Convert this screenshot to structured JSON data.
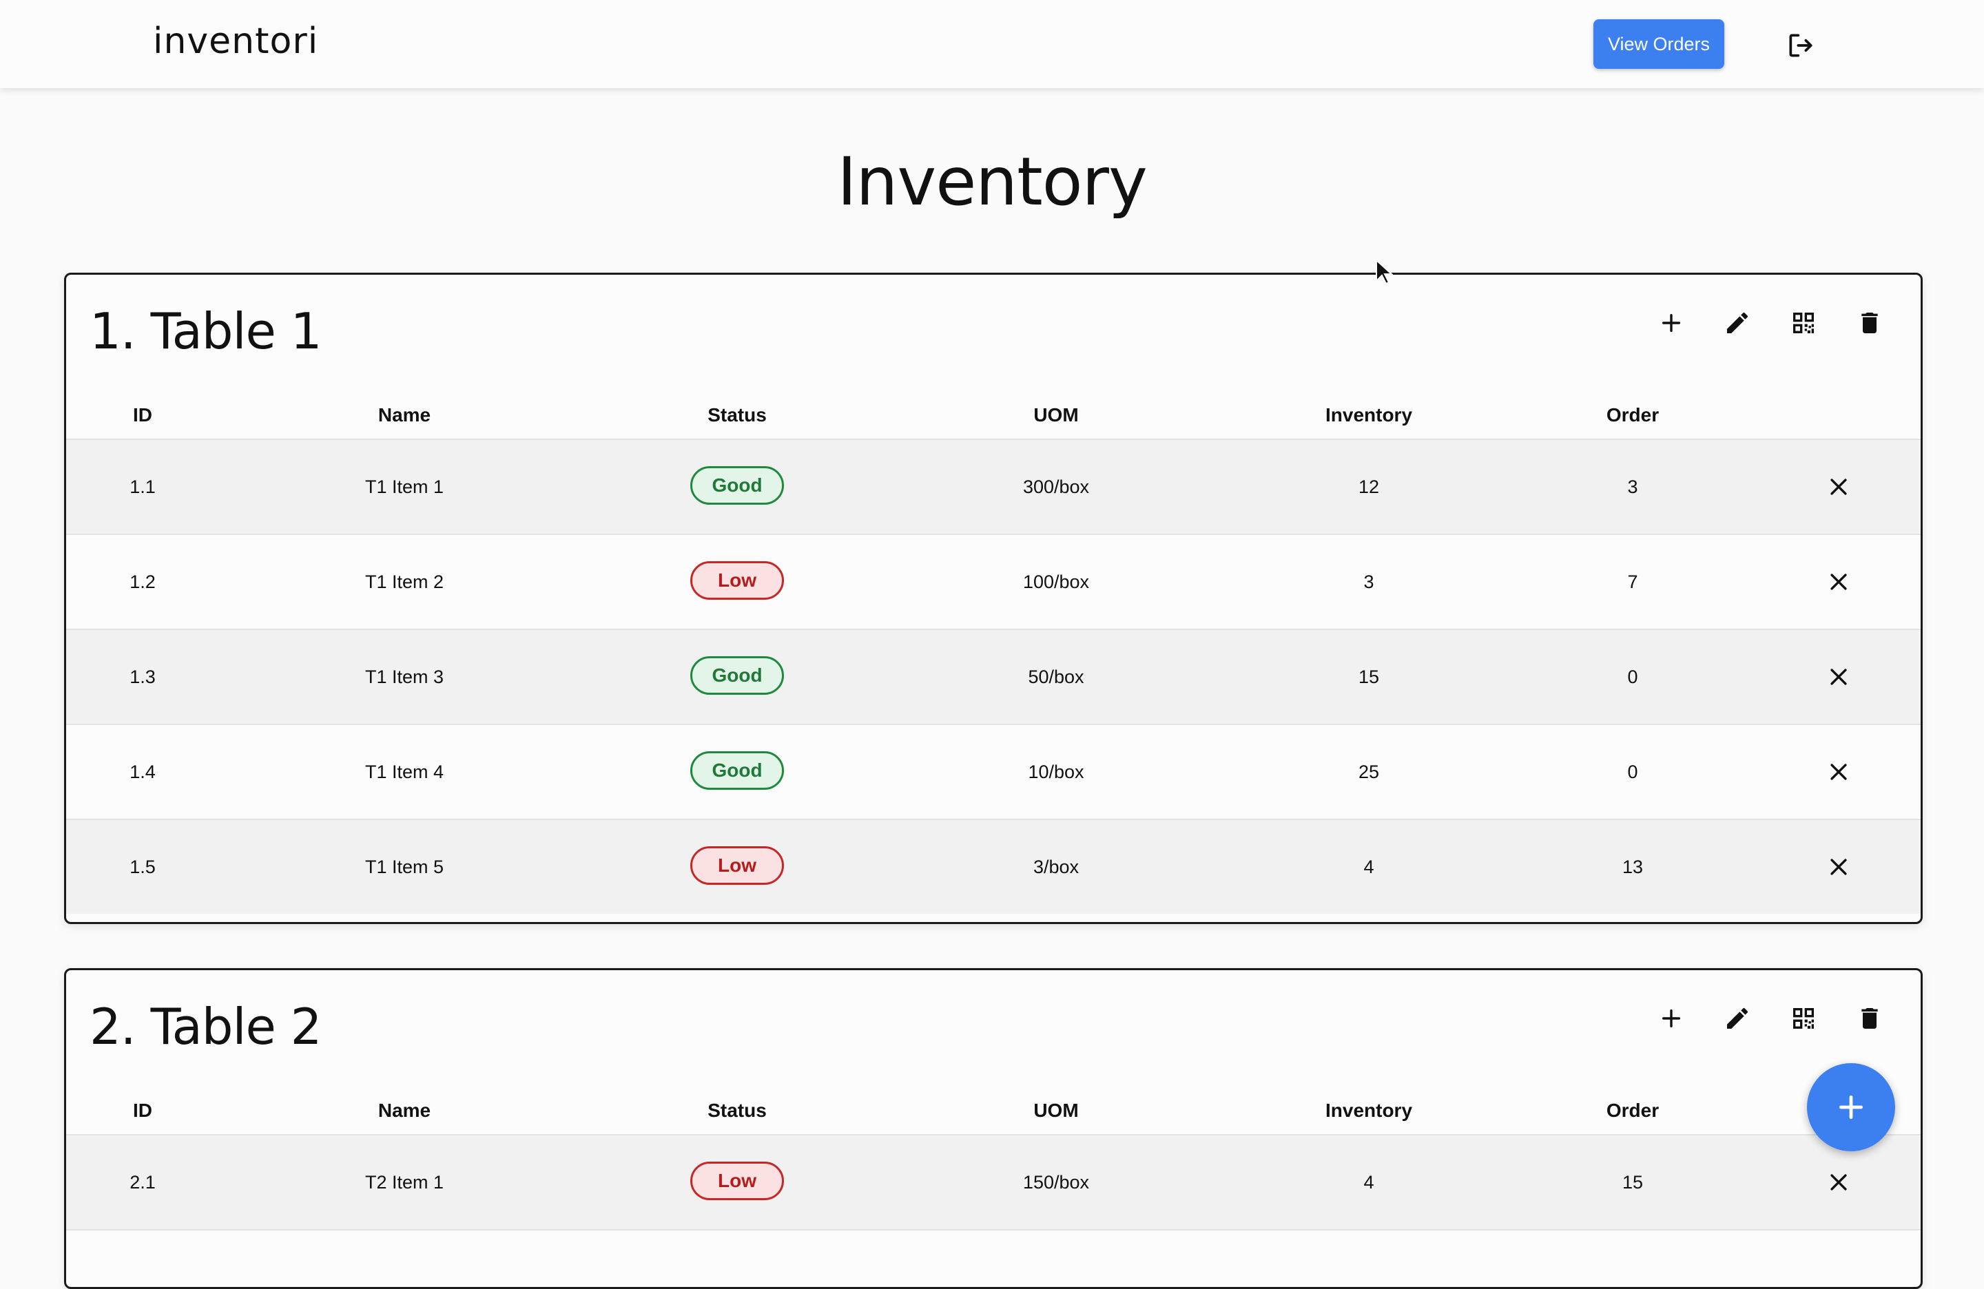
{
  "app": {
    "brand": "inventori",
    "view_orders_label": "View Orders",
    "page_title": "Inventory"
  },
  "icons": {
    "logout": "logout-icon",
    "add": "plus-icon",
    "edit": "pencil-icon",
    "qr": "qr-code-icon",
    "delete": "trash-icon",
    "remove_row": "close-icon",
    "fab": "plus-icon"
  },
  "colors": {
    "accent": "#3b7ff0",
    "good": "#1f8a3e",
    "low": "#c62828"
  },
  "columns": [
    "ID",
    "Name",
    "Status",
    "UOM",
    "Inventory",
    "Order"
  ],
  "tables": [
    {
      "title": "1. Table 1",
      "rows": [
        {
          "id": "1.1",
          "name": "T1 Item 1",
          "status": "Good",
          "uom": "300/box",
          "inventory": "12",
          "order": "3"
        },
        {
          "id": "1.2",
          "name": "T1 Item 2",
          "status": "Low",
          "uom": "100/box",
          "inventory": "3",
          "order": "7"
        },
        {
          "id": "1.3",
          "name": "T1 Item 3",
          "status": "Good",
          "uom": "50/box",
          "inventory": "15",
          "order": "0"
        },
        {
          "id": "1.4",
          "name": "T1 Item 4",
          "status": "Good",
          "uom": "10/box",
          "inventory": "25",
          "order": "0"
        },
        {
          "id": "1.5",
          "name": "T1 Item 5",
          "status": "Low",
          "uom": "3/box",
          "inventory": "4",
          "order": "13"
        }
      ]
    },
    {
      "title": "2. Table 2",
      "rows": [
        {
          "id": "2.1",
          "name": "T2 Item 1",
          "status": "Low",
          "uom": "150/box",
          "inventory": "4",
          "order": "15"
        }
      ]
    }
  ]
}
